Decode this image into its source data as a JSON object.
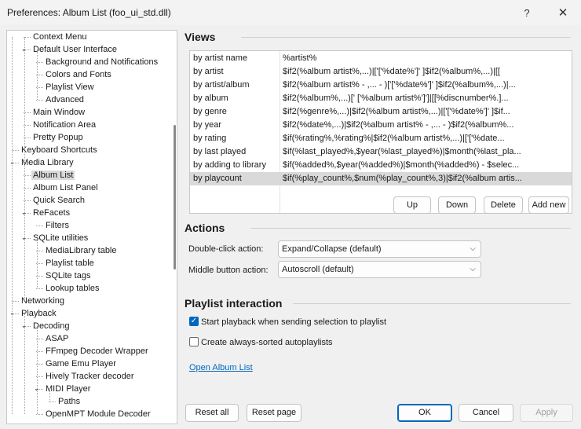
{
  "window": {
    "title": "Preferences: Album List (foo_ui_std.dll)",
    "help": "?",
    "close": "✕"
  },
  "tree": [
    {
      "label": "Context Menu",
      "level": 2,
      "expander": ""
    },
    {
      "label": "Default User Interface",
      "level": 2,
      "expander": "open"
    },
    {
      "label": "Background and Notifications",
      "level": 3,
      "expander": ""
    },
    {
      "label": "Colors and Fonts",
      "level": 3,
      "expander": ""
    },
    {
      "label": "Playlist View",
      "level": 3,
      "expander": ""
    },
    {
      "label": "Advanced",
      "level": 3,
      "expander": ""
    },
    {
      "label": "Main Window",
      "level": 2,
      "expander": ""
    },
    {
      "label": "Notification Area",
      "level": 2,
      "expander": ""
    },
    {
      "label": "Pretty Popup",
      "level": 2,
      "expander": ""
    },
    {
      "label": "Keyboard Shortcuts",
      "level": 1,
      "expander": ""
    },
    {
      "label": "Media Library",
      "level": 1,
      "expander": "open"
    },
    {
      "label": "Album List",
      "level": 2,
      "expander": "",
      "selected": true
    },
    {
      "label": "Album List Panel",
      "level": 2,
      "expander": ""
    },
    {
      "label": "Quick Search",
      "level": 2,
      "expander": ""
    },
    {
      "label": "ReFacets",
      "level": 2,
      "expander": "open"
    },
    {
      "label": "Filters",
      "level": 3,
      "expander": ""
    },
    {
      "label": "SQLite utilities",
      "level": 2,
      "expander": "open"
    },
    {
      "label": "MediaLibrary table",
      "level": 3,
      "expander": ""
    },
    {
      "label": "Playlist table",
      "level": 3,
      "expander": ""
    },
    {
      "label": "SQLite tags",
      "level": 3,
      "expander": ""
    },
    {
      "label": "Lookup tables",
      "level": 3,
      "expander": ""
    },
    {
      "label": "Networking",
      "level": 1,
      "expander": ""
    },
    {
      "label": "Playback",
      "level": 1,
      "expander": "open"
    },
    {
      "label": "Decoding",
      "level": 2,
      "expander": "open"
    },
    {
      "label": "ASAP",
      "level": 3,
      "expander": ""
    },
    {
      "label": "FFmpeg Decoder Wrapper",
      "level": 3,
      "expander": ""
    },
    {
      "label": "Game Emu Player",
      "level": 3,
      "expander": ""
    },
    {
      "label": "Hively Tracker decoder",
      "level": 3,
      "expander": ""
    },
    {
      "label": "MIDI Player",
      "level": 3,
      "expander": "open"
    },
    {
      "label": "Paths",
      "level": 4,
      "expander": ""
    },
    {
      "label": "OpenMPT Module Decoder",
      "level": 3,
      "expander": ""
    }
  ],
  "views": {
    "title": "Views",
    "rows": [
      {
        "name": "by artist name",
        "pattern": "%artist%"
      },
      {
        "name": "by artist",
        "pattern": "$if2(%album artist%,...)|['['%date%']' ]$if2(%album%,...)|[["
      },
      {
        "name": "by artist/album",
        "pattern": "$if2(%album artist% - ,... - )['['%date%']' ]$if2(%album%,...)|..."
      },
      {
        "name": "by album",
        "pattern": "$if2(%album%,...)[' ['%album artist%']']|[[%discnumber%.]..."
      },
      {
        "name": "by genre",
        "pattern": "$if2(%genre%,...)|$if2(%album artist%,...)|['['%date%']' ]$if..."
      },
      {
        "name": "by year",
        "pattern": "$if2(%date%,...)|$if2(%album artist% - ,... - )$if2(%album%..."
      },
      {
        "name": "by rating",
        "pattern": "$if(%rating%,%rating%|$if2(%album artist%,...)|['['%date..."
      },
      {
        "name": "by last played",
        "pattern": "$if(%last_played%,$year(%last_played%)|$month(%last_pla..."
      },
      {
        "name": "by adding to library",
        "pattern": "$if(%added%,$year(%added%)|$month(%added%) - $selec..."
      },
      {
        "name": "by playcount",
        "pattern": "$if(%play_count%,$num(%play_count%,3)|$if2(%album artis...",
        "selected": true
      }
    ],
    "buttons": {
      "up": "Up",
      "down": "Down",
      "delete": "Delete",
      "add_new": "Add new"
    }
  },
  "actions": {
    "title": "Actions",
    "double_click_label": "Double-click action:",
    "double_click_value": "Expand/Collapse (default)",
    "middle_button_label": "Middle button action:",
    "middle_button_value": "Autoscroll (default)"
  },
  "playlist": {
    "title": "Playlist interaction",
    "start_playback_label": "Start playback when sending selection to playlist",
    "start_playback_checked": true,
    "autoplaylists_label": "Create always-sorted autoplaylists",
    "autoplaylists_checked": false,
    "open_link": "Open Album List"
  },
  "footer": {
    "reset_all": "Reset all",
    "reset_page": "Reset page",
    "ok": "OK",
    "cancel": "Cancel",
    "apply": "Apply"
  },
  "colors": {
    "accent": "#0067c0",
    "selection": "#d9d9d9"
  }
}
